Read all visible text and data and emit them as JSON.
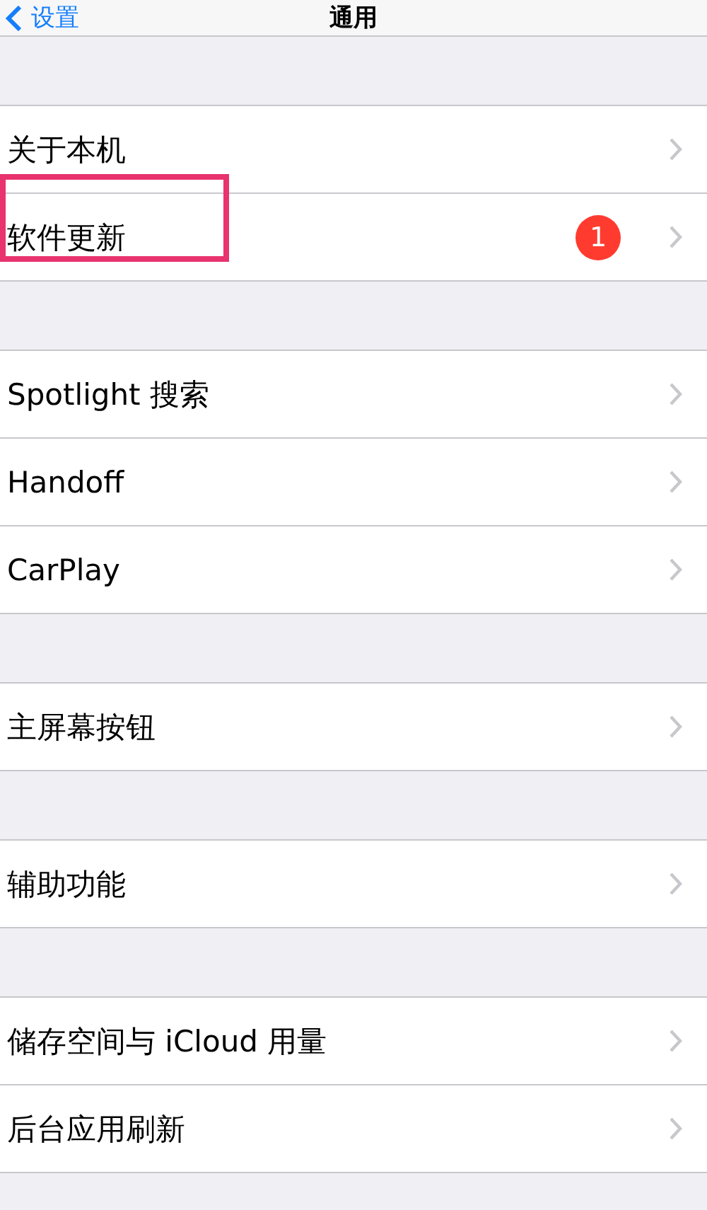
{
  "nav": {
    "back": "设置",
    "title": "通用"
  },
  "groups": [
    {
      "rows": [
        {
          "label": "关于本机"
        },
        {
          "label": "软件更新",
          "badge": "1",
          "annotated": true
        }
      ]
    },
    {
      "rows": [
        {
          "label": "Spotlight 搜索"
        },
        {
          "label": "Handoff"
        },
        {
          "label": "CarPlay"
        }
      ]
    },
    {
      "rows": [
        {
          "label": "主屏幕按钮"
        }
      ]
    },
    {
      "rows": [
        {
          "label": "辅助功能"
        }
      ]
    },
    {
      "rows": [
        {
          "label": "储存空间与 iCloud 用量"
        },
        {
          "label": "后台应用刷新"
        }
      ]
    }
  ]
}
